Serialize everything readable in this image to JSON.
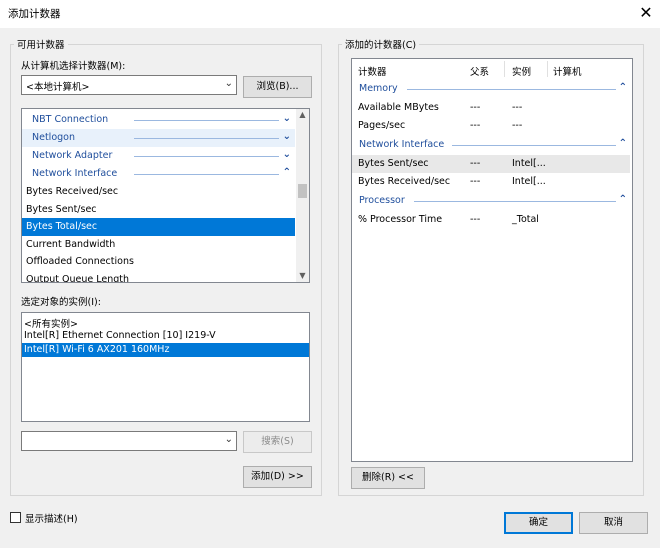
{
  "window": {
    "title": "添加计数器",
    "close_glyph": "✕"
  },
  "available": {
    "group_label": "可用计数器",
    "select_from_label": "从计算机选择计数器(M):",
    "computer_value": "<本地计算机>",
    "browse_button": "浏览(B)...",
    "objects": [
      {
        "label": "NBT Connection",
        "chevron": "⌄"
      },
      {
        "label": "Netlogon",
        "chevron": "⌄"
      },
      {
        "label": "Network Adapter",
        "chevron": "⌄"
      },
      {
        "label": "Network Interface",
        "chevron": "⌃"
      }
    ],
    "counters": [
      "Bytes Received/sec",
      "Bytes Sent/sec",
      "Bytes Total/sec",
      "Current Bandwidth",
      "Offloaded Connections",
      "Output Queue Length"
    ],
    "selected_counter": "Bytes Total/sec",
    "instances_label": "选定对象的实例(I):",
    "instances": [
      "<所有实例>",
      "Intel[R] Ethernet Connection [10] I219-V",
      "Intel[R] Wi-Fi 6 AX201 160MHz"
    ],
    "selected_instance": "Intel[R] Wi-Fi 6 AX201 160MHz",
    "search_value": "",
    "search_button": "搜索(S)",
    "add_button": "添加(D) >>"
  },
  "added": {
    "group_label": "添加的计数器(C)",
    "columns": [
      "计数器",
      "父系",
      "实例",
      "计算机"
    ],
    "groups": [
      {
        "name": "Memory",
        "rows": [
          {
            "counter": "Available MBytes",
            "parent": "---",
            "instance": "---",
            "computer": ""
          },
          {
            "counter": "Pages/sec",
            "parent": "---",
            "instance": "---",
            "computer": ""
          }
        ]
      },
      {
        "name": "Network Interface",
        "rows": [
          {
            "counter": "Bytes Sent/sec",
            "parent": "---",
            "instance": "Intel[...",
            "computer": ""
          },
          {
            "counter": "Bytes Received/sec",
            "parent": "---",
            "instance": "Intel[...",
            "computer": ""
          }
        ]
      },
      {
        "name": "Processor",
        "rows": [
          {
            "counter": "% Processor Time",
            "parent": "---",
            "instance": "_Total",
            "computer": ""
          }
        ]
      }
    ],
    "selected_counter": "Bytes Sent/sec",
    "collapse_glyph": "⌃",
    "remove_button": "删除(R) <<"
  },
  "footer": {
    "show_description_label": "显示描述(H)",
    "show_description_checked": false,
    "ok_button": "确定",
    "cancel_button": "取消"
  },
  "colors": {
    "selection": "#0078d7",
    "group_text": "#1f4e9c"
  }
}
